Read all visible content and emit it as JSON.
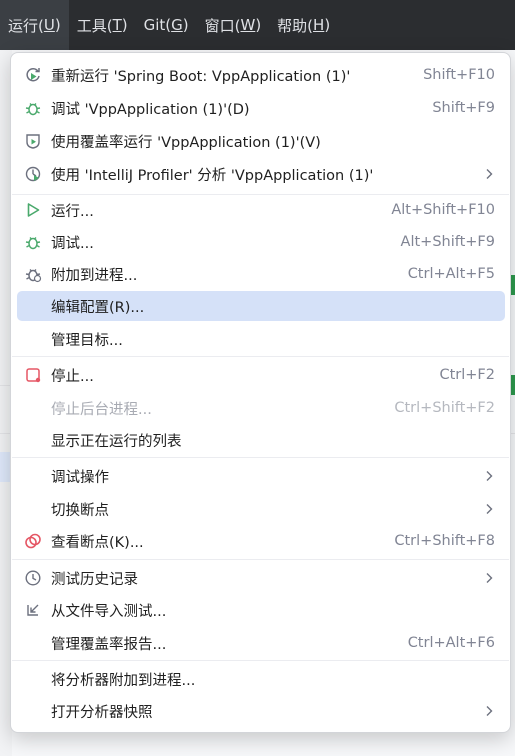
{
  "menubar": {
    "items": [
      {
        "label": "运行(",
        "mn": "U",
        "end": ")"
      },
      {
        "label": "工具(",
        "mn": "T",
        "end": ")"
      },
      {
        "label": "Git(",
        "mn": "G",
        "end": ")"
      },
      {
        "label": "窗口(",
        "mn": "W",
        "end": ")"
      },
      {
        "label": "帮助(",
        "mn": "H",
        "end": ")"
      }
    ]
  },
  "menu": {
    "items": [
      {
        "label": "重新运行 'Spring Boot: VppApplication (1)'",
        "shortcut": "Shift+F10",
        "icon": "rerun-icon"
      },
      {
        "label": "调试 'VppApplication (1)'(D)",
        "shortcut": "Shift+F9",
        "icon": "debug-icon"
      },
      {
        "label": "使用覆盖率运行 'VppApplication (1)'(V)",
        "shortcut": "",
        "icon": "coverage-icon"
      },
      {
        "label": "使用 'IntelliJ Profiler' 分析  'VppApplication (1)'",
        "shortcut": "",
        "icon": "profiler-icon",
        "submenu": true
      },
      {
        "label": "运行...",
        "shortcut": "Alt+Shift+F10",
        "icon": "run-icon"
      },
      {
        "label": "调试...",
        "shortcut": "Alt+Shift+F9",
        "icon": "debug-icon"
      },
      {
        "label": "附加到进程...",
        "shortcut": "Ctrl+Alt+F5",
        "icon": "attach-icon"
      },
      {
        "label": "编辑配置(R)...",
        "shortcut": "",
        "icon": ""
      },
      {
        "label": "管理目标...",
        "shortcut": "",
        "icon": ""
      },
      {
        "label": "停止...",
        "shortcut": "Ctrl+F2",
        "icon": "stop-icon"
      },
      {
        "label": "停止后台进程...",
        "shortcut": "Ctrl+Shift+F2",
        "icon": ""
      },
      {
        "label": "显示正在运行的列表",
        "shortcut": "",
        "icon": ""
      },
      {
        "label": "调试操作",
        "shortcut": "",
        "icon": "",
        "submenu": true
      },
      {
        "label": "切换断点",
        "shortcut": "",
        "icon": "",
        "submenu": true
      },
      {
        "label": "查看断点(K)...",
        "shortcut": "Ctrl+Shift+F8",
        "icon": "breakpoints-icon"
      },
      {
        "label": "测试历史记录",
        "shortcut": "",
        "icon": "history-icon",
        "submenu": true
      },
      {
        "label": "从文件导入测试...",
        "shortcut": "",
        "icon": "import-icon"
      },
      {
        "label": "管理覆盖率报告...",
        "shortcut": "Ctrl+Alt+F6",
        "icon": ""
      },
      {
        "label": "将分析器附加到进程...",
        "shortcut": "",
        "icon": ""
      },
      {
        "label": "打开分析器快照",
        "shortcut": "",
        "icon": "",
        "submenu": true
      }
    ]
  },
  "colors": {
    "menubar_bg": "#2b2d30",
    "highlight": "#d5e1f8",
    "run_green": "#4aa96c",
    "stop_red": "#e55765"
  }
}
